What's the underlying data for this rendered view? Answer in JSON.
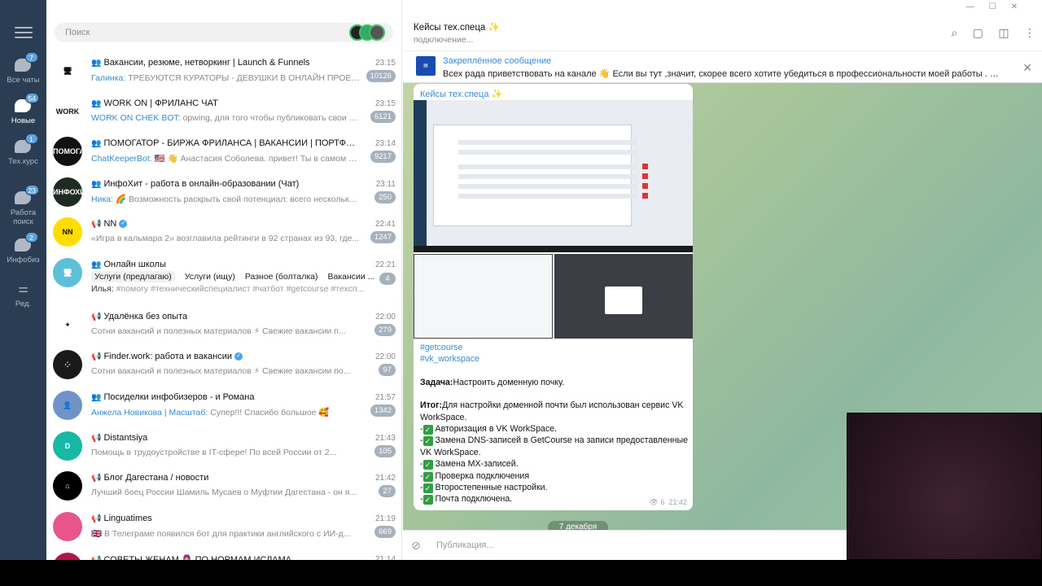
{
  "rail": {
    "folders": [
      {
        "label": "Все чаты",
        "badge": "7"
      },
      {
        "label": "Новые",
        "badge": "54"
      },
      {
        "label": "Тех.курс",
        "badge": "1"
      },
      {
        "label": "Работа поиск",
        "badge": "23"
      },
      {
        "label": "Инфобиз",
        "badge": "2"
      },
      {
        "label": "Ред.",
        "badge": ""
      }
    ]
  },
  "search": {
    "placeholder": "Поиск"
  },
  "chats": [
    {
      "kind": "group",
      "title": "Вакансии, резюме, нетворкинг | Launch & Funnels",
      "time": "23:15",
      "sender": "Галинка: ",
      "preview": "ТРЕБУЮТСЯ  КУРАТОРЫ - ДЕВУШКИ В ОНЛАЙН ПРОЕКТ 🔥 #...",
      "count": "10126",
      "avatar_color": "#ffffff",
      "avatar_text": "🖥"
    },
    {
      "kind": "group",
      "title": "WORK ON | ФРИЛАНС ЧАТ",
      "time": "23:15",
      "sender": "WORK ON CHEK BOT: ",
      "preview": "opwing, для того чтобы публиковать свои об...",
      "count": "6121",
      "avatar_color": "#ffffff",
      "avatar_text": "WORK ON"
    },
    {
      "kind": "group",
      "title": "ПОМОГАТОР - БИРЖА ФРИЛАНСА | ВАКАНСИИ | ПОРТФОЛИ...",
      "time": "23:14",
      "sender": "ChatKeeperBot: ",
      "preview": "🇺🇸 👋 Анастасия Соболева. привет! Ты в самом кр...",
      "count": "9217",
      "avatar_color": "#111111",
      "avatar_text": "ПОМОГАТОР"
    },
    {
      "kind": "group",
      "title": "ИнфоХит - работа в онлайн-образовании (Чат)",
      "time": "23:11",
      "sender": "Ника: ",
      "preview": "🌈 Возможность раскрыть свой потенциал: всего несколько...",
      "count": "250",
      "avatar_color": "#1d2b22",
      "avatar_text": "ИНФОХИТ"
    },
    {
      "kind": "channel",
      "title": "NN",
      "verified": true,
      "time": "22:41",
      "sender": "",
      "preview": "«Игра в кальмара 2» возглавила рейтинги в 92 странах из 93, где...",
      "count": "1247",
      "avatar_color": "#ffdd00",
      "avatar_text": "NN"
    },
    {
      "kind": "group",
      "title": "Онлайн школы",
      "time": "22:21",
      "topics": [
        "Услуги (предлагаю)",
        "Услуги (ищу)",
        "Разное (болталка)",
        "Вакансии ..."
      ],
      "sender": "Илья: ",
      "preview": "#помогу #техническийспециалист #чатбот #getcourse #техсп...",
      "count": "4",
      "avatar_color": "#5bc0d8",
      "avatar_text": "🖥"
    },
    {
      "kind": "channel",
      "title": "Удалёнка без опыта",
      "time": "22:00",
      "sender": "",
      "preview": "Сотни вакансий и полезных материалов ⚡ Свежие вакансии п...",
      "count": "279",
      "avatar_color": "#ffffff",
      "avatar_text": "✦"
    },
    {
      "kind": "channel",
      "title": "Finder.work: работа и вакансии",
      "verified": true,
      "time": "22:00",
      "sender": "",
      "preview": "Сотни вакансий и полезных материалов ⚡ Свежие вакансии по...",
      "count": "97",
      "avatar_color": "#1a1a1a",
      "avatar_text": "⁘"
    },
    {
      "kind": "group",
      "title": "Посиделки инфобизеров - и Романа",
      "time": "21:57",
      "sender": "Анжела Новикова | Масштаб: ",
      "preview": "Супер!!! Спасибо большое 🥰",
      "count": "1342",
      "avatar_color": "#6f93c7",
      "avatar_text": "👤"
    },
    {
      "kind": "channel",
      "title": "Distantsiya",
      "time": "21:43",
      "sender": "",
      "preview": "Помощь в трудоустройстве в IT-сфере!  По всей России от 2...",
      "count": "105",
      "avatar_color": "#18b8a6",
      "avatar_text": "D"
    },
    {
      "kind": "channel",
      "title": "Блог Дагестана / новости",
      "time": "21:42",
      "sender": "",
      "preview": "Лучший боец России Шамиль Мусаев о Муфтии Дагестана - он я...",
      "count": "27",
      "avatar_color": "#000000",
      "avatar_text": "⌂"
    },
    {
      "kind": "channel",
      "title": "Linguatimes",
      "time": "21:19",
      "sender": "",
      "preview": "🇬🇧 В Телеграме появился бот для практики английского с ИИ-д...",
      "count": "669",
      "avatar_color": "#e8558a",
      "avatar_text": ""
    },
    {
      "kind": "channel",
      "title": "СОВЕТЫ ЖЕНАМ 🧕 ПО НОРМАМ ИСЛАМА",
      "time": "21:14",
      "sender": "",
      "preview": "",
      "count": "",
      "avatar_color": "#b0184a",
      "avatar_text": ""
    }
  ],
  "channel": {
    "title": "Кейсы тех.спеца ✨",
    "status": "подключение...",
    "pinned_title": "Закреплённое сообщение",
    "pinned_text": "Всех рада приветствовать на канале 👋  Если вы тут ,значит, скорее всего хотите убедиться в профессиональности моей работы . Мож..."
  },
  "message": {
    "author": "Кейсы тех.спеца ✨",
    "tags": [
      "#getcourse",
      "#vk_workspace"
    ],
    "task_label": "Задача:",
    "task_text": "Настроить доменную почку.",
    "result_label": "Итог:",
    "result_text": "Для настройки доменной почти был использован сервис VK WorkSpace.",
    "steps": [
      "Авторизация в VK WorkSpace.",
      "Замена DNS-записей в GetCourse на записи предоставленные VK WorkSpace.",
      "Замена MX-записей.",
      "Проверка подключения",
      "Второстепенные настройки.",
      "Почта подключена."
    ],
    "views": "6",
    "time": "21:42"
  },
  "date_pill": "7 декабря",
  "composer": {
    "placeholder": "Публикация..."
  }
}
